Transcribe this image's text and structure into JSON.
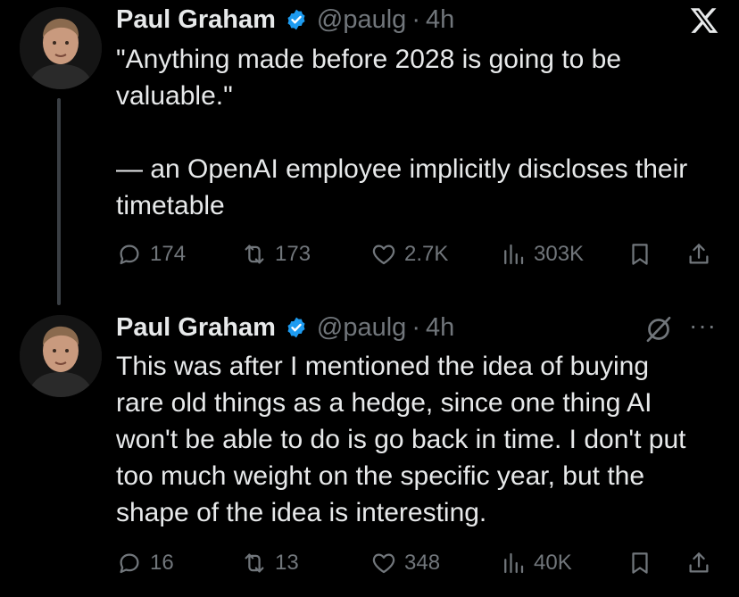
{
  "colors": {
    "background": "#000000",
    "text": "#e7e9ea",
    "muted": "#71767b",
    "verified": "#1d9bf0",
    "thread_line": "#3a3f44"
  },
  "tweets": [
    {
      "author": "Paul Graham",
      "handle": "@paulg",
      "separator": "·",
      "time": "4h",
      "text": "\"Anything made before 2028 is going to be valuable.\"\n\n— an OpenAI employee implicitly discloses their timetable",
      "replies": "174",
      "reposts": "173",
      "likes": "2.7K",
      "views": "303K"
    },
    {
      "author": "Paul Graham",
      "handle": "@paulg",
      "separator": "·",
      "time": "4h",
      "text": "This was after I mentioned the idea of buying rare old things as a hedge, since one thing AI won't be able to do is go back in time. I don't put too much weight on the specific year, but the shape of the idea is interesting.",
      "replies": "16",
      "reposts": "13",
      "likes": "348",
      "views": "40K"
    }
  ],
  "icons": {
    "logo": "x-logo-icon",
    "verified": "verified-badge-icon",
    "reply": "reply-icon",
    "repost": "repost-icon",
    "like": "heart-icon",
    "views": "views-chart-icon",
    "bookmark": "bookmark-icon",
    "share": "share-icon",
    "grok": "grok-icon",
    "more": "more-icon"
  },
  "more_glyph": "···"
}
